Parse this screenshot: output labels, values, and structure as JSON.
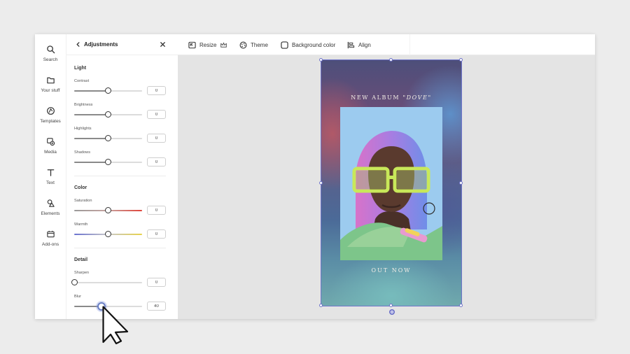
{
  "rail": {
    "items": [
      {
        "label": "Search",
        "icon": "search-icon"
      },
      {
        "label": "Your stuff",
        "icon": "folder-icon"
      },
      {
        "label": "Templates",
        "icon": "templates-icon"
      },
      {
        "label": "Media",
        "icon": "media-icon"
      },
      {
        "label": "Text",
        "icon": "text-icon"
      },
      {
        "label": "Elements",
        "icon": "elements-icon"
      },
      {
        "label": "Add-ons",
        "icon": "add-ons-icon"
      }
    ]
  },
  "panel": {
    "title": "Adjustments",
    "sections": {
      "light": {
        "title": "Light",
        "sliders": [
          {
            "label": "Contrast",
            "value": "0",
            "position": 0.5
          },
          {
            "label": "Brightness",
            "value": "0",
            "position": 0.5
          },
          {
            "label": "Highlights",
            "value": "0",
            "position": 0.5
          },
          {
            "label": "Shadows",
            "value": "0",
            "position": 0.5
          }
        ]
      },
      "color": {
        "title": "Color",
        "sliders": [
          {
            "label": "Saturation",
            "value": "0",
            "position": 0.5
          },
          {
            "label": "Warmth",
            "value": "0",
            "position": 0.5
          }
        ]
      },
      "detail": {
        "title": "Detail",
        "sliders": [
          {
            "label": "Sharpen",
            "value": "0",
            "position": 0.0
          },
          {
            "label": "Blur",
            "value": "40",
            "position": 0.4
          }
        ]
      }
    }
  },
  "toolbar": {
    "resize": "Resize",
    "theme": "Theme",
    "background_color": "Background color",
    "align": "Align"
  },
  "design": {
    "headline_prefix": "NEW ALBUM",
    "headline_title": "\"DOVE\"",
    "cta": "OUT NOW"
  },
  "colors": {
    "selection": "#6f74c9",
    "active_thumb": "#6a7fc4"
  }
}
